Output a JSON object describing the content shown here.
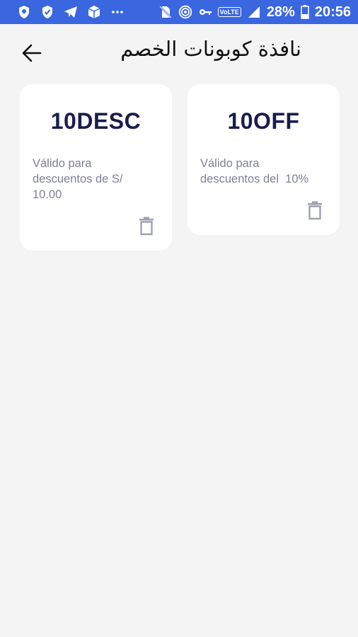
{
  "status_bar": {
    "icons": [
      "shield-icon",
      "shield-check-icon",
      "telegram-icon",
      "package-icon",
      "more-icon",
      "no-sim-icon",
      "hotspot-icon",
      "key-icon",
      "volte-icon",
      "signal-icon",
      "battery-icon"
    ],
    "volte_label": "VoLTE",
    "battery": "28%",
    "time": "20:56"
  },
  "header": {
    "title": "نافذة كوبونات الخصم",
    "back_icon": "arrow-left-icon"
  },
  "coupons": [
    {
      "code": "10DESC",
      "description": "Válido para\ndescuentos de S/\n10.00"
    },
    {
      "code": "10OFF",
      "description": "Válido para\ndescuentos del  10%"
    }
  ],
  "colors": {
    "status_bar": "#3a66e0",
    "background": "#f4f4f4",
    "card": "#ffffff",
    "code_text": "#1b1d4d",
    "desc_text": "#7e8193",
    "trash_icon": "#9ea1b0"
  }
}
